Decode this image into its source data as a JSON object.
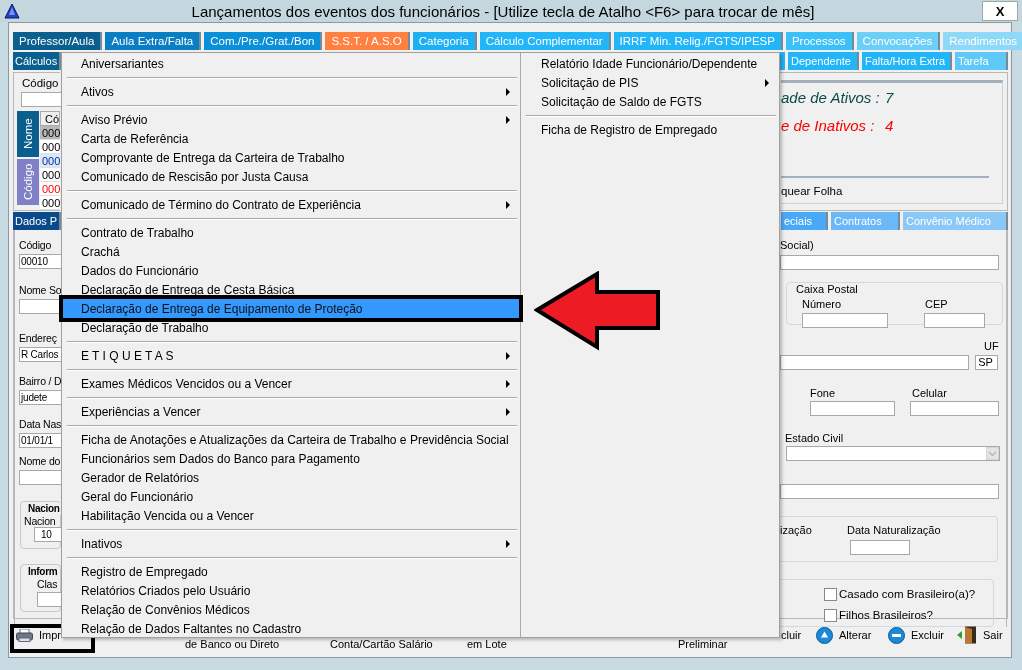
{
  "window": {
    "title": "Lançamentos dos eventos dos funcionários - [Utilize tecla de Atalho <F6> para trocar de mês]",
    "close_label": "X"
  },
  "tabs_row_1": [
    {
      "label": "Professor/Aula",
      "color": "#0b5f8f"
    },
    {
      "label": "Aula Extra/Falta",
      "color": "#0a7ec2"
    },
    {
      "label": "Com./Pre./Grat./Bon",
      "color": "#0a8fd8"
    },
    {
      "label": "S.S.T. / A.S.O",
      "color": "#ff8040"
    },
    {
      "label": "Categoria",
      "color": "#1eb0f5"
    },
    {
      "label": "Cálculo Complementar",
      "color": "#22b6f8"
    },
    {
      "label": "IRRF Min. Relig./FGTS/IPESP",
      "color": "#22b6f8"
    },
    {
      "label": "Processos",
      "color": "#3cc0f8"
    },
    {
      "label": "Convocações",
      "color": "#6ccff8"
    },
    {
      "label": "Rendimentos",
      "color": "#8ed8f8"
    }
  ],
  "tabs_row_2": [
    {
      "label": "Cálculos",
      "color": "#0b5f8f"
    },
    {
      "label": "Dependente",
      "color": "#22b6f8"
    },
    {
      "label": "Falta/Hora Extra",
      "color": "#22b6f8"
    },
    {
      "label": "Tarefa",
      "color": "#5ec8f8"
    }
  ],
  "employee_list": {
    "search_label": "Código",
    "vertical_tabs": [
      {
        "label": "Nome",
        "selected": true
      },
      {
        "label": "Código",
        "selected": false
      }
    ],
    "header": "Có",
    "rows": [
      {
        "code": "000",
        "selected": true,
        "highlighted": false,
        "inactive": false
      },
      {
        "code": "000",
        "selected": false,
        "highlighted": false,
        "inactive": false
      },
      {
        "code": "000",
        "selected": false,
        "highlighted": true,
        "inactive": false
      },
      {
        "code": "000",
        "selected": false,
        "highlighted": false,
        "inactive": false
      },
      {
        "code": "000",
        "selected": false,
        "highlighted": false,
        "inactive": true
      },
      {
        "code": "000",
        "selected": false,
        "highlighted": false,
        "inactive": false
      }
    ]
  },
  "summary": {
    "active_label": "ade de Ativos :",
    "active_count": "7",
    "inactive_label": "e de Inativos :",
    "inactive_count": "4",
    "option_label": "quear Folha"
  },
  "tabs_row_3": [
    {
      "label": "Dados P",
      "color": "#0a4a8a"
    },
    {
      "label": "eciais",
      "color": "#4aa8f8"
    },
    {
      "label": "Contratos",
      "color": "#6ab8f8"
    },
    {
      "label": "Convênio Médico",
      "color": "#8ac8f8"
    }
  ],
  "left_form": {
    "fields": [
      {
        "label": "Código",
        "value": "00010"
      },
      {
        "label": "Nome So"
      },
      {
        "label": "Endereç",
        "value": "R Carlos"
      },
      {
        "label": "Bairro / D",
        "value": "judete"
      },
      {
        "label": "Data Nas",
        "value": "01/01/1"
      },
      {
        "label": "Nome do"
      }
    ],
    "groups": [
      {
        "legend": "Nacion",
        "label": "Nacion",
        "value": "10"
      },
      {
        "legend": "Inform",
        "label": "Clas"
      }
    ]
  },
  "right_form": {
    "social_label": "Social)",
    "caixa_postal": {
      "legend": "Caixa Postal",
      "numero_label": "Número",
      "cep_label": "CEP"
    },
    "uf_label": "UF",
    "uf_value": "SP",
    "fone_label": "Fone",
    "celular_label": "Celular",
    "estado_civil_label": "Estado Civil",
    "naturalizacao_label": "ização",
    "data_naturalizacao_label": "Data Naturalização",
    "checkboxes": [
      {
        "label": "Casado com Brasileiro(a)?",
        "checked": false
      },
      {
        "label": "Filhos Brasileiros?",
        "checked": false
      }
    ]
  },
  "toolbar": [
    {
      "label": "Impr",
      "kind": "print"
    },
    {
      "label": "de Banco ou Direto",
      "kind": "plain"
    },
    {
      "label": "Conta/Cartão Salário",
      "kind": "plain"
    },
    {
      "label": "em Lote",
      "kind": "plain"
    },
    {
      "label": "Preliminar",
      "kind": "plain"
    },
    {
      "label": "cluir",
      "kind": "text"
    },
    {
      "label": "Alterar",
      "kind": "edit"
    },
    {
      "label": "Excluir",
      "kind": "delete"
    },
    {
      "label": "Sair",
      "kind": "exit"
    }
  ],
  "menu": {
    "columns": [
      {
        "items": [
          {
            "kind": "item",
            "label": "Aniversariantes",
            "submenu": false,
            "selected": false
          },
          {
            "kind": "separator"
          },
          {
            "kind": "item",
            "label": "Ativos",
            "submenu": true,
            "selected": false
          },
          {
            "kind": "separator"
          },
          {
            "kind": "item",
            "label": "Aviso Prévio",
            "submenu": true,
            "selected": false
          },
          {
            "kind": "item",
            "label": "Carta de Referência",
            "submenu": false,
            "selected": false
          },
          {
            "kind": "item",
            "label": "Comprovante de Entrega da Carteira de Trabalho",
            "submenu": false,
            "selected": false
          },
          {
            "kind": "item",
            "label": "Comunicado de Rescisão por Justa Causa",
            "submenu": false,
            "selected": false
          },
          {
            "kind": "separator"
          },
          {
            "kind": "item",
            "label": "Comunicado de Término do Contrato de Experiência",
            "submenu": true,
            "selected": false
          },
          {
            "kind": "separator"
          },
          {
            "kind": "item",
            "label": "Contrato de Trabalho",
            "submenu": false,
            "selected": false
          },
          {
            "kind": "item",
            "label": "Crachá",
            "submenu": false,
            "selected": false
          },
          {
            "kind": "item",
            "label": "Dados do Funcionário",
            "submenu": false,
            "selected": false
          },
          {
            "kind": "item",
            "label": "Declaração de Entrega de Cesta Básica",
            "submenu": false,
            "selected": false
          },
          {
            "kind": "item",
            "label": "Declaração de Entrega de Equipamento de Proteção",
            "submenu": false,
            "selected": true
          },
          {
            "kind": "item",
            "label": "Declaração de Trabalho",
            "submenu": false,
            "selected": false
          },
          {
            "kind": "separator"
          },
          {
            "kind": "item",
            "label": "E T I Q U E T A S",
            "submenu": true,
            "selected": false
          },
          {
            "kind": "separator"
          },
          {
            "kind": "item",
            "label": "Exames Médicos Vencidos ou a Vencer",
            "submenu": true,
            "selected": false
          },
          {
            "kind": "separator"
          },
          {
            "kind": "item",
            "label": "Experiências a Vencer",
            "submenu": true,
            "selected": false
          },
          {
            "kind": "separator"
          },
          {
            "kind": "item",
            "label": "Ficha de Anotações e Atualizações da Carteira de Trabalho e Previdência Social",
            "submenu": false,
            "selected": false
          },
          {
            "kind": "item",
            "label": "Funcionários sem Dados do Banco para Pagamento",
            "submenu": false,
            "selected": false
          },
          {
            "kind": "item",
            "label": "Gerador de Relatórios",
            "submenu": false,
            "selected": false
          },
          {
            "kind": "item",
            "label": "Geral do Funcionário",
            "submenu": false,
            "selected": false
          },
          {
            "kind": "item",
            "label": "Habilitação Vencida ou a Vencer",
            "submenu": false,
            "selected": false
          },
          {
            "kind": "separator"
          },
          {
            "kind": "item",
            "label": "Inativos",
            "submenu": true,
            "selected": false
          },
          {
            "kind": "separator"
          },
          {
            "kind": "item",
            "label": "Registro de Empregado",
            "submenu": false,
            "selected": false
          },
          {
            "kind": "item",
            "label": "Relatórios Criados pelo Usuário",
            "submenu": false,
            "selected": false
          },
          {
            "kind": "item",
            "label": "Relação de Convênios Médicos",
            "submenu": false,
            "selected": false
          },
          {
            "kind": "item",
            "label": "Relação de Dados Faltantes no Cadastro",
            "submenu": false,
            "selected": false
          }
        ]
      },
      {
        "items": [
          {
            "kind": "item",
            "label": "Relatório Idade Funcionário/Dependente",
            "submenu": false,
            "selected": false
          },
          {
            "kind": "item",
            "label": "Solicitação de PIS",
            "submenu": true,
            "selected": false
          },
          {
            "kind": "item",
            "label": "Solicitação de Saldo de FGTS",
            "submenu": false,
            "selected": false
          },
          {
            "kind": "separator"
          },
          {
            "kind": "item",
            "label": "Ficha de Registro de Empregado",
            "submenu": false,
            "selected": false
          }
        ]
      }
    ]
  }
}
